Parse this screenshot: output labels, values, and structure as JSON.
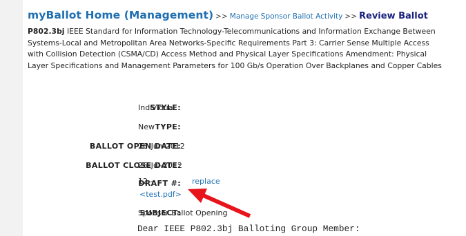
{
  "breadcrumb": {
    "home": "myBallot Home (Management)",
    "separator": ">>",
    "manage": "Manage Sponsor Ballot Activity",
    "current": "Review Ballot"
  },
  "project": {
    "id": "P802.3bj",
    "title": "IEEE Standard for Information Technology-Telecommunications and Information Exchange Between Systems-Local and Metropolitan Area Networks-Specific Requirements Part 3: Carrier Sense Multiple Access with Collision Detection (CSMA/CD) Access Method and Physical Layer Specifications Amendment: Physical Layer Specifications and Management Parameters for 100 Gb/s Operation Over Backplanes and Copper Cables"
  },
  "fields": {
    "style_label": "STYLE:",
    "style_value": "Individual",
    "type_label": "TYPE:",
    "type_value": "New",
    "open_label": "BALLOT OPEN DATE:",
    "open_value": "26-Jun-2012",
    "close_label": "BALLOT CLOSE DATE:",
    "close_value": "26-Jul-2012",
    "draft_label": "DRAFT #:",
    "draft_value": "12 --",
    "replace_link": "replace",
    "draft_file": "<test.pdf>",
    "subject_label": "SUBJECT:",
    "subject_value": "Sponsor Ballot Opening"
  },
  "letter": {
    "greeting": "Dear IEEE P802.3bj Balloting Group Member:"
  },
  "colors": {
    "link": "#1f6fb2",
    "current_crumb": "#1a237e",
    "arrow": "#e8141c",
    "side_strip": "#f2f2f2"
  }
}
